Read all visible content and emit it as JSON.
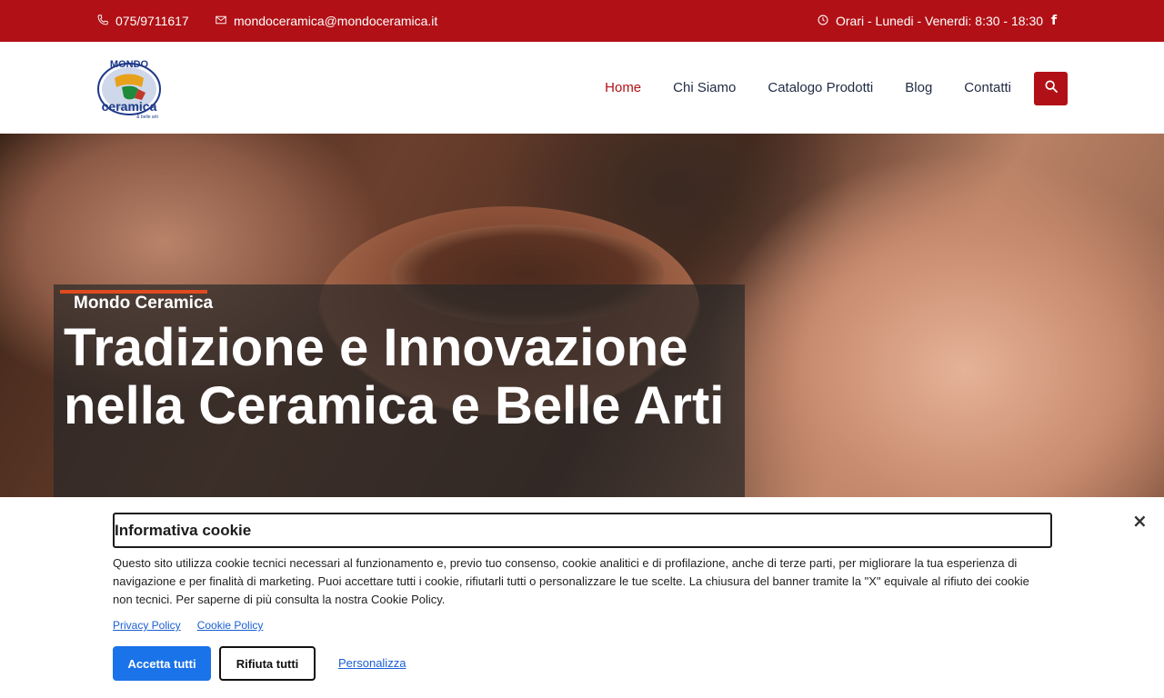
{
  "topbar": {
    "phone": "075/9711617",
    "email": "mondoceramica@mondoceramica.it",
    "hours": "Orari - Lunedi - Venerdi: 8:30 - 18:30",
    "facebook_icon": "f"
  },
  "header": {
    "logo_text_top": "MONDO",
    "logo_text_bottom": "ceramica",
    "logo_text_small": "& belle arti",
    "nav": [
      {
        "label": "Home"
      },
      {
        "label": "Chi Siamo"
      },
      {
        "label": "Catalogo Prodotti"
      },
      {
        "label": "Blog"
      },
      {
        "label": "Contatti"
      }
    ]
  },
  "hero": {
    "kicker": "Mondo Ceramica",
    "headline": "Tradizione e Innovazione nella Ceramica e Belle Arti"
  },
  "cookie": {
    "title": "Informativa cookie",
    "close": "×",
    "text": "Questo sito utilizza cookie tecnici necessari al funzionamento e, previo tuo consenso, cookie analitici e di profilazione, anche di terze parti, per migliorare la tua esperienza di navigazione e per finalità di marketing. Puoi accettare tutti i cookie, rifiutarli tutti o personalizzare le tue scelte. La chiusura del banner tramite la \"X\" equivale al rifiuto dei cookie non tecnici. Per saperne di più consulta la nostra Cookie Policy.",
    "privacy_link": "Privacy Policy",
    "cookie_link": "Cookie Policy",
    "accept": "Accetta tutti",
    "reject": "Rifiuta tutti",
    "customize": "Personalizza"
  },
  "colors": {
    "brand_red": "#b11116",
    "accent_orange": "#e04a1f",
    "link_blue": "#1a5fd6",
    "button_blue": "#1a73e8"
  }
}
